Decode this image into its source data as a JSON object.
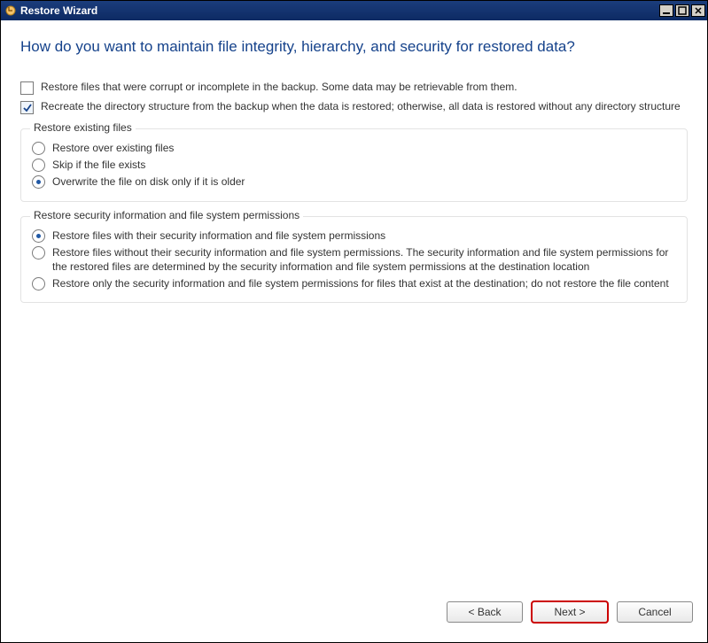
{
  "title": "Restore Wizard",
  "heading": "How do you want to maintain file integrity, hierarchy, and security for restored data?",
  "checkboxes": {
    "restore_corrupt": {
      "label": "Restore files that were corrupt or incomplete in the backup. Some data may be retrievable from them.",
      "checked": false
    },
    "recreate_dir": {
      "label": "Recreate the directory structure from the backup when the data is restored; otherwise, all data is restored without any directory structure",
      "checked": true
    }
  },
  "groups": {
    "existing": {
      "legend": "Restore existing files",
      "options": [
        {
          "label": "Restore over existing files",
          "selected": false
        },
        {
          "label": "Skip if the file exists",
          "selected": false
        },
        {
          "label": "Overwrite the file on disk only if it is older",
          "selected": true
        }
      ]
    },
    "security": {
      "legend": "Restore security information and file system permissions",
      "options": [
        {
          "label": "Restore files with their security information and file system permissions",
          "selected": true
        },
        {
          "label": "Restore files without their security information and file system permissions. The security information and file system permissions for the restored files are determined by the security information and file system permissions at the destination location",
          "selected": false
        },
        {
          "label": "Restore only the security information and file system permissions for files that exist at the destination; do not restore the file content",
          "selected": false
        }
      ]
    }
  },
  "buttons": {
    "back": "< Back",
    "next": "Next >",
    "cancel": "Cancel"
  }
}
